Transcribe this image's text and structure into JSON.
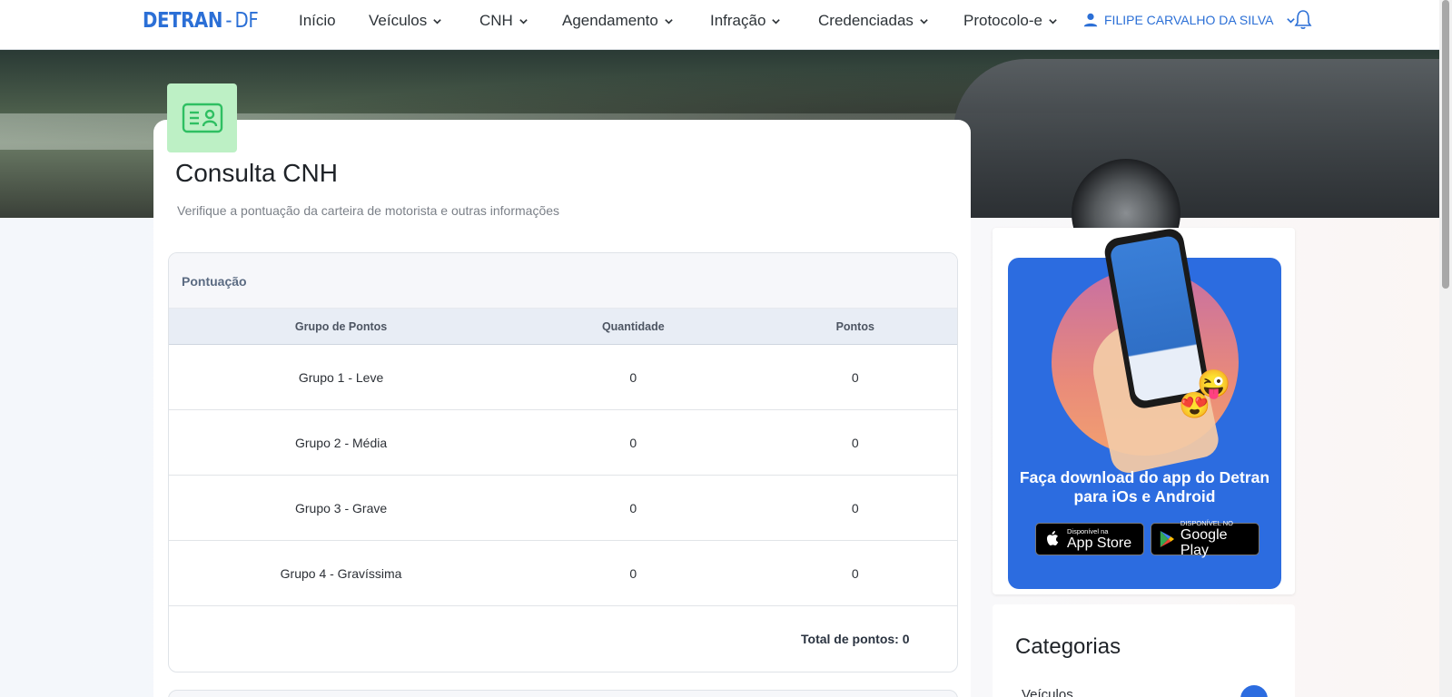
{
  "nav": {
    "logo_main": "DETRAN",
    "logo_sep": "-",
    "logo_region": "DF",
    "items": [
      {
        "label": "Início"
      },
      {
        "label": "Veículos"
      },
      {
        "label": "CNH"
      },
      {
        "label": "Agendamento"
      },
      {
        "label": "Infração"
      },
      {
        "label": "Credenciadas"
      },
      {
        "label": "Protocolo-e"
      }
    ],
    "user_name": "FILIPE CARVALHO DA SILVA"
  },
  "page": {
    "title": "Consulta CNH",
    "subtitle": "Verifique a pontuação da carteira de motorista e outras informações"
  },
  "pontuacao": {
    "caption": "Pontuação",
    "headers": [
      "Grupo de Pontos",
      "Quantidade",
      "Pontos"
    ],
    "rows": [
      {
        "grupo": "Grupo 1 - Leve",
        "quantidade": "0",
        "pontos": "0"
      },
      {
        "grupo": "Grupo 2 - Média",
        "quantidade": "0",
        "pontos": "0"
      },
      {
        "grupo": "Grupo 3 - Grave",
        "quantidade": "0",
        "pontos": "0"
      },
      {
        "grupo": "Grupo 4 - Gravíssima",
        "quantidade": "0",
        "pontos": "0"
      }
    ],
    "total": "Total de pontos: 0"
  },
  "promo": {
    "text": "Faça download do app do Detran para iOs e Android",
    "appstore_small": "Disponível na",
    "appstore_big": "App Store",
    "googleplay_small": "DISPONÍVEL NO",
    "googleplay_big": "Google Play"
  },
  "categorias": {
    "title": "Categorias",
    "items": [
      {
        "label": "Veículos"
      }
    ]
  },
  "colors": {
    "brand": "#2b6fd6",
    "promo_bg": "#2c6ce0",
    "icon_bg": "#bdf0c5"
  }
}
